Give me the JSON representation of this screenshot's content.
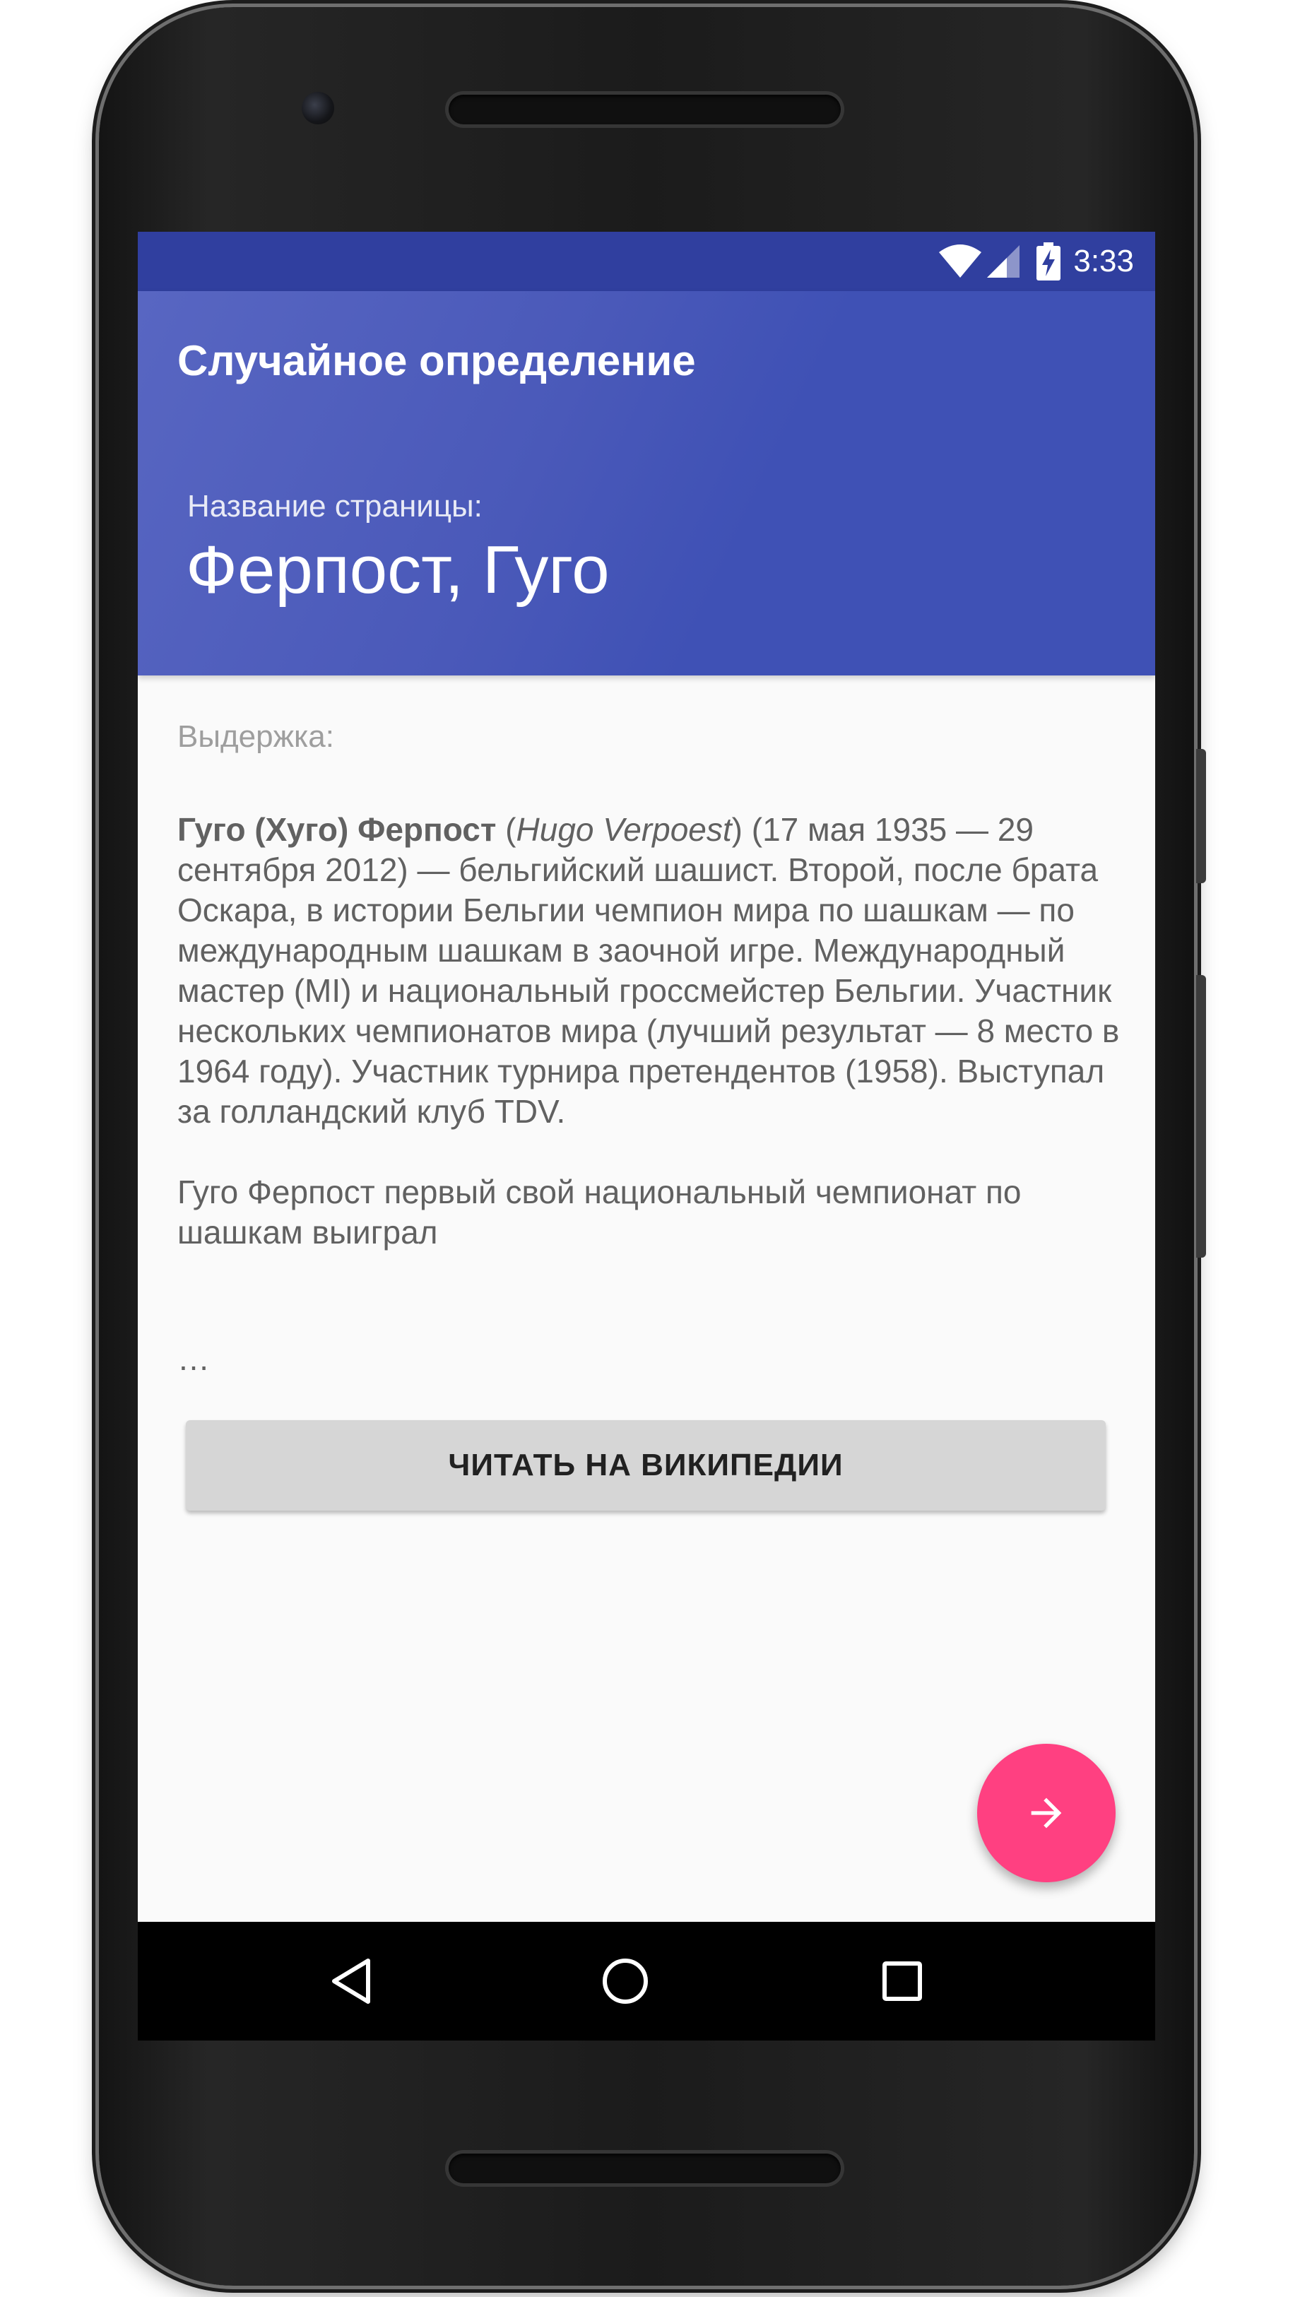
{
  "status_bar": {
    "time": "3:33",
    "icons": [
      "wifi-icon",
      "cell-signal-icon",
      "battery-charging-icon"
    ],
    "color": "#303f9f"
  },
  "app": {
    "title": "Случайное определение",
    "header_color": "#3f51b5"
  },
  "page": {
    "name_label": "Название страницы:",
    "name": "Ферпост, Гуго"
  },
  "excerpt": {
    "label": "Выдержка:",
    "name_bold": "Гуго (Хуго) Ферпост",
    "open_paren": " (",
    "original_name": "Hugo Verpoest",
    "paragraph1_rest": ") (17 мая 1935 — 29 сентября 2012) — бельгийский шашист. Второй, после брата Оскара, в истории Бельгии чемпион мира по шашкам — по международным шашкам в заочной игре. Международный мастер (MI) и национальный гроссмейстер Бельгии. Участник нескольких чемпионатов мира (лучший результат — 8 место в 1964 году). Участник турнира претендентов (1958). Выступал за голландский клуб TDV.",
    "paragraph2": "Гуго Ферпост первый свой национальный чемпионат по шашкам выиграл",
    "ellipsis": "…"
  },
  "actions": {
    "read_button_label": "ЧИТАТЬ НА ВИКИПЕДИИ",
    "fab_icon": "arrow-forward-icon",
    "fab_color": "#ff4081"
  },
  "nav_bar": {
    "icons": [
      "back-icon",
      "home-icon",
      "recents-icon"
    ]
  }
}
